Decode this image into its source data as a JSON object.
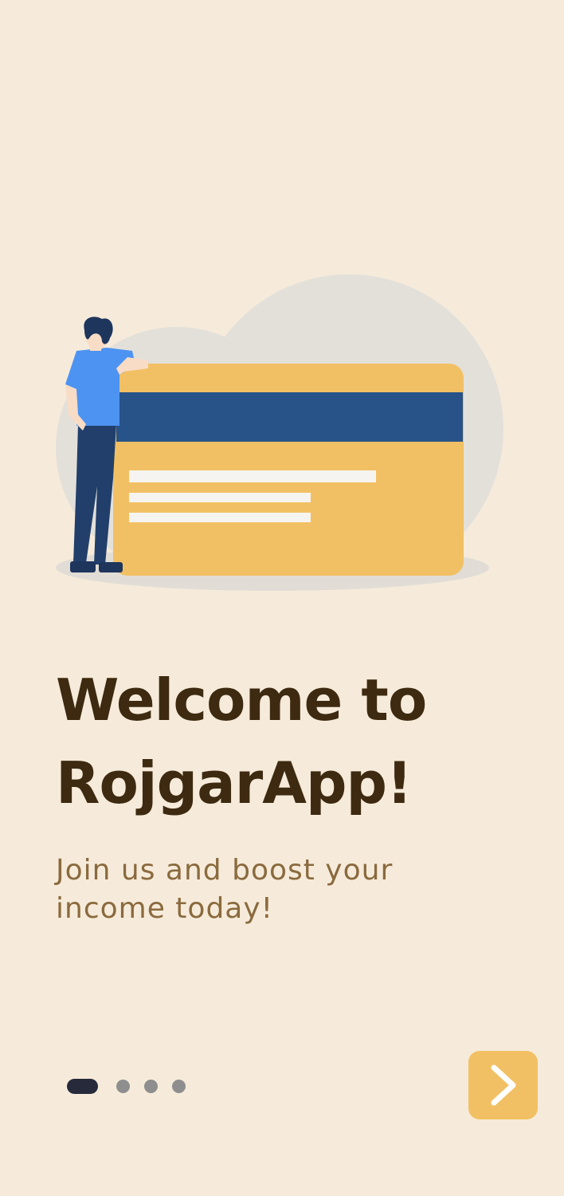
{
  "onboarding": {
    "title_lines": [
      "Welcome to",
      "RojgarApp!"
    ],
    "subtitle_lines": [
      "Join us and boost your",
      "income today!"
    ]
  },
  "pagination": {
    "total_pages": 4,
    "current_page": 1
  },
  "next_button": {
    "icon": "chevron-right-icon"
  },
  "colors": {
    "background": "#f6ebda",
    "card": "#f2c064",
    "card_stripe": "#275389",
    "title": "#3d2a10",
    "subtitle": "#8a6a3e",
    "active_dot": "#262a3a",
    "inactive_dot": "#8e8e8e",
    "button": "#f2c064"
  }
}
